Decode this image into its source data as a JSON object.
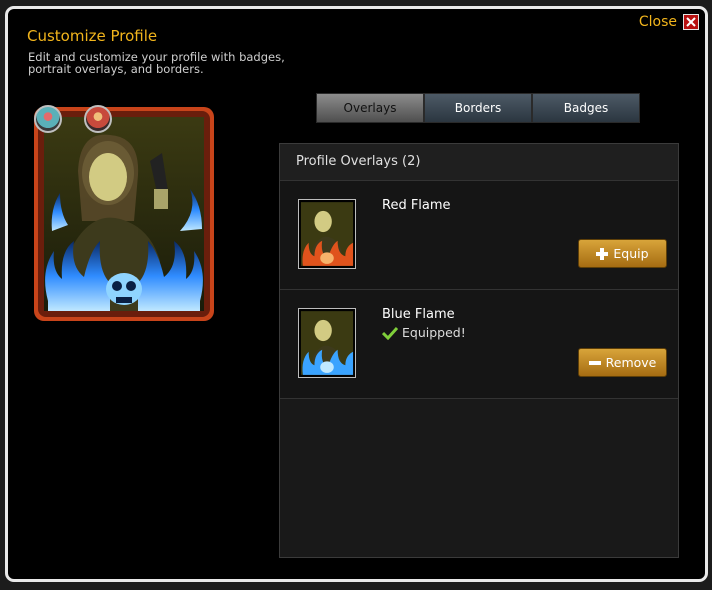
{
  "dialog": {
    "title": "Customize Profile",
    "subtitle": "Edit and customize your profile with badges, portrait overlays, and borders.",
    "close_label": "Close"
  },
  "tabs": [
    {
      "label": "Overlays",
      "active": true
    },
    {
      "label": "Borders",
      "active": false
    },
    {
      "label": "Badges",
      "active": false
    }
  ],
  "panel": {
    "header": "Profile Overlays (2)",
    "items": [
      {
        "name": "Red Flame",
        "status": "",
        "button_label": "Equip",
        "button_icon": "plus-icon"
      },
      {
        "name": "Blue Flame",
        "status": "Equipped!",
        "button_label": "Remove",
        "button_icon": "minus-icon"
      }
    ]
  },
  "colors": {
    "accent": "#f2b51c",
    "button": "#c98c24",
    "blue_flame": "#3aa3ff",
    "red_flame": "#e0531c"
  }
}
